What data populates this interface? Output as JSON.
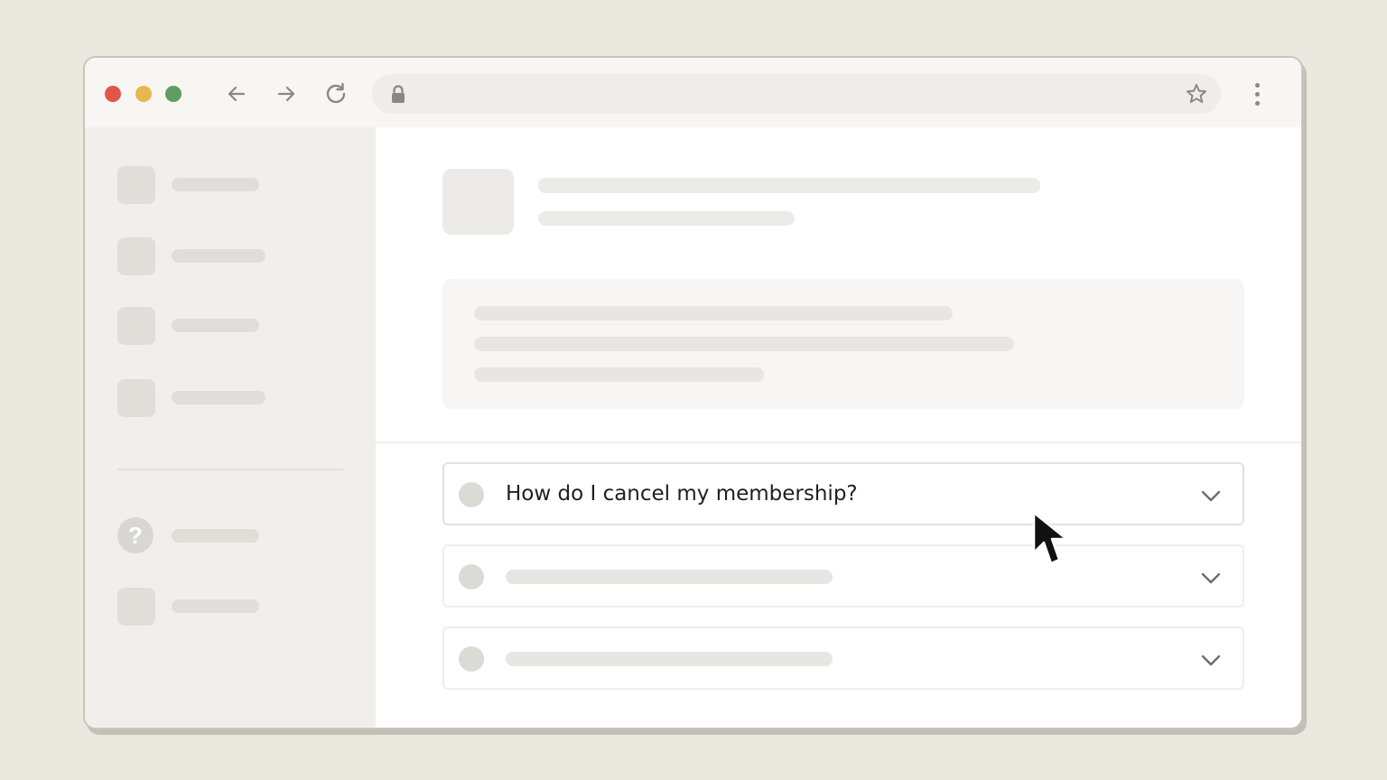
{
  "browser": {
    "address": "",
    "colors": {
      "close": "#e0574a",
      "minimize": "#e7b84f",
      "zoom": "#5f9e5e"
    },
    "icons": {
      "back": "arrow-left-icon",
      "forward": "arrow-right-icon",
      "reload": "reload-icon",
      "lock": "lock-icon",
      "bookmark": "star-icon",
      "menu": "kebab-menu-icon"
    }
  },
  "sidebar": {
    "help_symbol": "?"
  },
  "faq": {
    "items": [
      {
        "question": "How do I cancel my membership?",
        "expanded": false
      },
      {
        "question": "",
        "expanded": false
      },
      {
        "question": "",
        "expanded": false
      }
    ]
  }
}
